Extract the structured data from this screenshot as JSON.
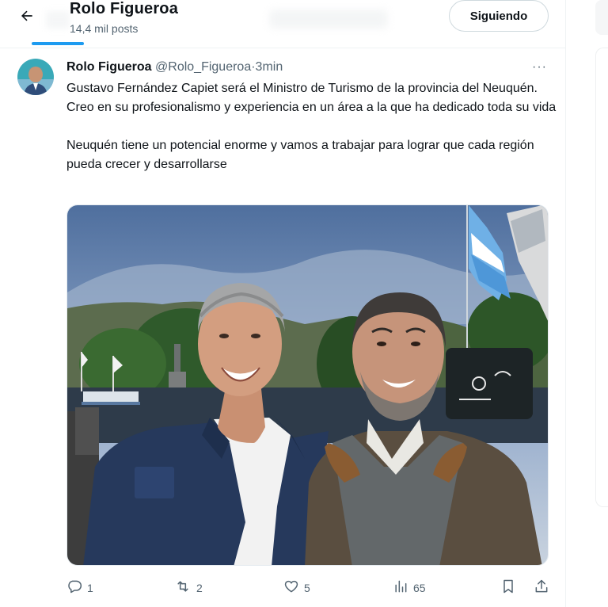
{
  "header": {
    "title": "Rolo Figueroa",
    "post_count": "14,4 mil posts",
    "follow_label": "Siguiendo"
  },
  "tweet": {
    "author_name": "Rolo Figueroa",
    "handle": "@Rolo_Figueroa",
    "separator": "·",
    "time": "3min",
    "more": "···",
    "paragraph1": "Gustavo Fernández Capiet será el  Ministro de Turismo de la provincia del Neuquén. Creo en su profesionalismo y experiencia en un área a la que ha dedicado toda su vida",
    "paragraph2": "Neuquén tiene un potencial enorme y vamos a trabajar para lograr que cada región pueda crecer y desarrollarse"
  },
  "actions": {
    "replies": "1",
    "reposts": "2",
    "likes": "5",
    "views": "65"
  },
  "colors": {
    "accent": "#1d9bf0",
    "secondary_text": "#536471",
    "primary_text": "#0f1419"
  },
  "icons": [
    "back-arrow-icon",
    "more-icon",
    "reply-icon",
    "repost-icon",
    "like-icon",
    "views-icon",
    "bookmark-icon",
    "share-icon"
  ]
}
